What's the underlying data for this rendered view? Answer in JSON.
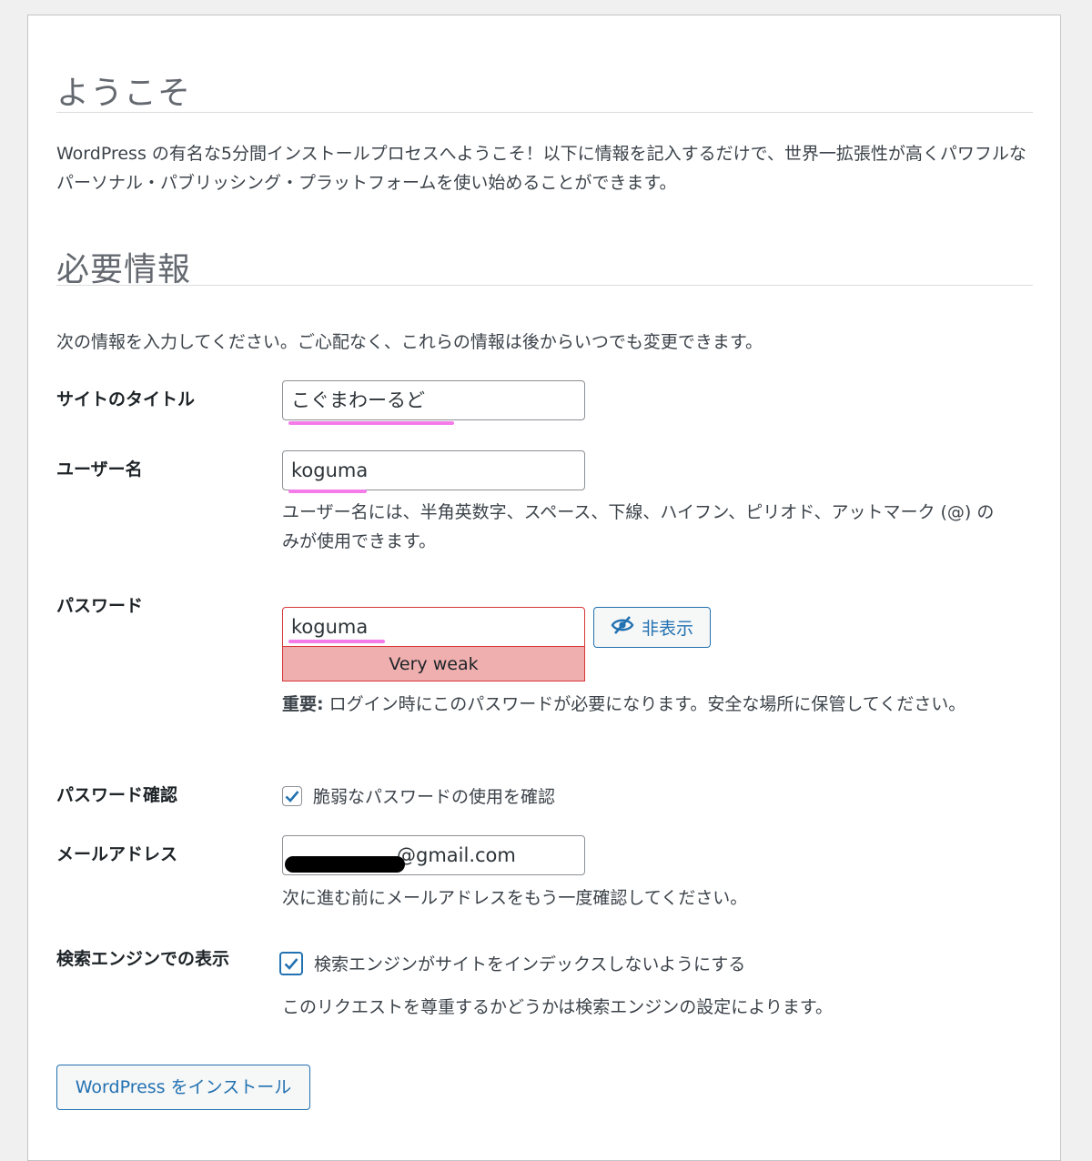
{
  "welcome": {
    "title": "ようこそ",
    "intro": "WordPress の有名な5分間インストールプロセスへようこそ！以下に情報を記入するだけで、世界一拡張性が高くパワフルなパーソナル・パブリッシング・プラットフォームを使い始めることができます。"
  },
  "required": {
    "title": "必要情報",
    "lead": "次の情報を入力してください。ご心配なく、これらの情報は後からいつでも変更できます。"
  },
  "site_title": {
    "label": "サイトのタイトル",
    "value": "こぐまわーるど"
  },
  "username": {
    "label": "ユーザー名",
    "value": "koguma",
    "help": "ユーザー名には、半角英数字、スペース、下線、ハイフン、ピリオド、アットマーク (@) のみが使用できます。"
  },
  "password": {
    "label": "パスワード",
    "value": "koguma",
    "hide_label": "非表示",
    "hide_icon": "eye-slash-icon",
    "strength": "Very weak",
    "strength_color": "#f0afaf",
    "note_bold": "重要:",
    "note": " ログイン時にこのパスワードが必要になります。安全な場所に保管してください。"
  },
  "confirm": {
    "label": "パスワード確認",
    "checkbox_label": "脆弱なパスワードの使用を確認",
    "checked": true
  },
  "email": {
    "label": "メールアドレス",
    "value": "@gmail.com",
    "help": "次に進む前にメールアドレスをもう一度確認してください。"
  },
  "privacy": {
    "label": "検索エンジンでの表示",
    "checkbox_label": "検索エンジンがサイトをインデックスしないようにする",
    "checked": true,
    "help": "このリクエストを尊重するかどうかは検索エンジンの設定によります。"
  },
  "install_button": "WordPress をインストール",
  "colors": {
    "accent": "#2271b1",
    "highlight_underline": "#f47ce9",
    "error_border": "#d63638"
  }
}
